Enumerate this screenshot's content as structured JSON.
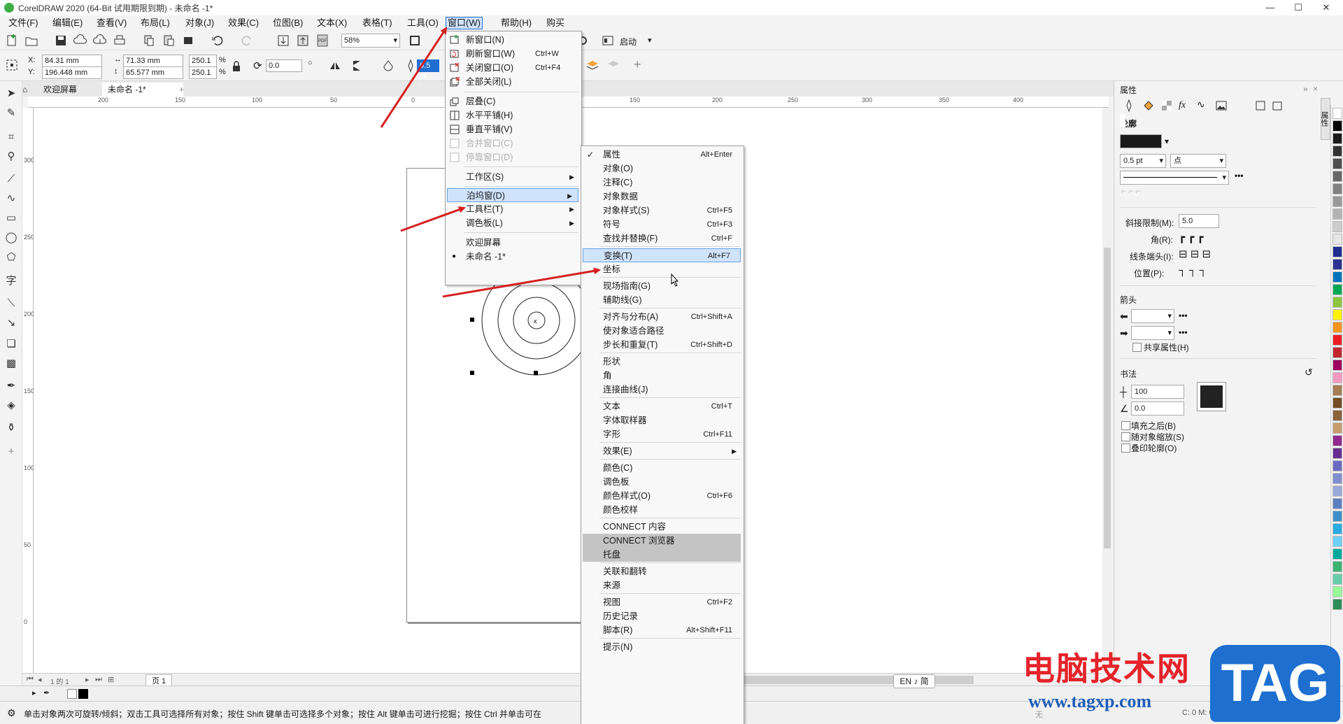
{
  "window": {
    "title": "CorelDRAW 2020 (64-Bit 试用期限到期) - 未命名 -1*",
    "controls": [
      "—",
      "☐",
      "✕"
    ]
  },
  "menubar": [
    "文件(F)",
    "编辑(E)",
    "查看(V)",
    "布局(L)",
    "对象(J)",
    "效果(C)",
    "位图(B)",
    "文本(X)",
    "表格(T)",
    "工具(O)",
    "窗口(W)",
    "帮助(H)",
    "购买"
  ],
  "toolbar": {
    "zoom": "58%",
    "launch_label": "启动"
  },
  "property_bar": {
    "x_label": "X:",
    "y_label": "Y:",
    "x_value": "84.31 mm",
    "y_value": "196.448 mm",
    "w_value": "71.33 mm",
    "h_value": "65.577 mm",
    "scale_x": "250.1",
    "scale_y": "250.1",
    "percent": "%",
    "rotation": "0.0",
    "outline_width": "0.5 pt"
  },
  "tabs": {
    "welcome": "欢迎屏幕",
    "document": "未命名 -1*"
  },
  "ruler_top": [
    "200",
    "150",
    "100",
    "50",
    "0",
    "50",
    "100",
    "150",
    "200",
    "250",
    "300",
    "350",
    "400"
  ],
  "ruler_left": [
    "300",
    "250",
    "200",
    "150",
    "100",
    "50",
    "0"
  ],
  "window_menu": {
    "items": [
      {
        "label": "新窗口(N)",
        "shortcut": ""
      },
      {
        "label": "刷新窗口(W)",
        "shortcut": "Ctrl+W"
      },
      {
        "label": "关闭窗口(O)",
        "shortcut": "Ctrl+F4"
      },
      {
        "label": "全部关闭(L)",
        "shortcut": ""
      },
      {
        "label": "层叠(C)",
        "shortcut": ""
      },
      {
        "label": "水平平铺(H)",
        "shortcut": ""
      },
      {
        "label": "垂直平铺(V)",
        "shortcut": ""
      },
      {
        "label": "合并窗口(C)",
        "shortcut": ""
      },
      {
        "label": "停靠窗口(D)",
        "shortcut": ""
      },
      {
        "label": "工作区(S)",
        "shortcut": ""
      },
      {
        "label": "泊坞窗(D)",
        "shortcut": ""
      },
      {
        "label": "工具栏(T)",
        "shortcut": ""
      },
      {
        "label": "调色板(L)",
        "shortcut": ""
      },
      {
        "label": "欢迎屏幕",
        "shortcut": ""
      },
      {
        "label": "未命名 -1*",
        "shortcut": ""
      }
    ]
  },
  "docker_submenu": {
    "items": [
      {
        "label": "属性",
        "shortcut": "Alt+Enter"
      },
      {
        "label": "对象(O)",
        "shortcut": ""
      },
      {
        "label": "注释(C)",
        "shortcut": ""
      },
      {
        "label": "对象数据",
        "shortcut": ""
      },
      {
        "label": "对象样式(S)",
        "shortcut": "Ctrl+F5"
      },
      {
        "label": "符号",
        "shortcut": "Ctrl+F3"
      },
      {
        "label": "查找并替换(F)",
        "shortcut": "Ctrl+F"
      },
      {
        "label": "变换(T)",
        "shortcut": "Alt+F7"
      },
      {
        "label": "坐标",
        "shortcut": ""
      },
      {
        "label": "现场指南(G)",
        "shortcut": ""
      },
      {
        "label": "辅助线(G)",
        "shortcut": ""
      },
      {
        "label": "对齐与分布(A)",
        "shortcut": "Ctrl+Shift+A"
      },
      {
        "label": "使对象适合路径",
        "shortcut": ""
      },
      {
        "label": "步长和重复(T)",
        "shortcut": "Ctrl+Shift+D"
      },
      {
        "label": "形状",
        "shortcut": ""
      },
      {
        "label": "角",
        "shortcut": ""
      },
      {
        "label": "连接曲线(J)",
        "shortcut": ""
      },
      {
        "label": "文本",
        "shortcut": "Ctrl+T"
      },
      {
        "label": "字体取样器",
        "shortcut": ""
      },
      {
        "label": "字形",
        "shortcut": "Ctrl+F11"
      },
      {
        "label": "效果(E)",
        "shortcut": ""
      },
      {
        "label": "颜色(C)",
        "shortcut": ""
      },
      {
        "label": "调色板",
        "shortcut": ""
      },
      {
        "label": "颜色样式(O)",
        "shortcut": "Ctrl+F6"
      },
      {
        "label": "颜色校样",
        "shortcut": ""
      },
      {
        "label": "CONNECT 内容",
        "shortcut": ""
      },
      {
        "label": "CONNECT 浏览器",
        "shortcut": ""
      },
      {
        "label": "托盘",
        "shortcut": ""
      },
      {
        "label": "关联和翻转",
        "shortcut": ""
      },
      {
        "label": "来源",
        "shortcut": ""
      },
      {
        "label": "视图",
        "shortcut": "Ctrl+F2"
      },
      {
        "label": "历史记录",
        "shortcut": ""
      },
      {
        "label": "脚本(R)",
        "shortcut": "Alt+Shift+F11"
      },
      {
        "label": "提示(N)",
        "shortcut": ""
      }
    ]
  },
  "docker": {
    "title": "属性",
    "section_outline": "轮廓",
    "width_value": "0.5 pt",
    "unit": "点",
    "miter_label": "斜接限制(M):",
    "miter_value": "5.0",
    "corner_label": "角(R):",
    "linecap_label": "线条端头(I):",
    "position_label": "位置(P):",
    "arrows_label": "箭头",
    "share_label": "共享属性(H)",
    "calligraphy_label": "书法",
    "stretch_value": "100",
    "angle_value": "0.0",
    "fill_behind": "填充之后(B)",
    "scale_with": "随对象缩放(S)",
    "overprint": "叠印轮廓(O)",
    "vertical_tab": "属性"
  },
  "palette_colors": [
    "#ffffff",
    "#000000",
    "#1a1a1a",
    "#333333",
    "#4d4d4d",
    "#666666",
    "#808080",
    "#999999",
    "#b3b3b3",
    "#cccccc",
    "#e6e6e6",
    "#1d2c8f",
    "#2e3192",
    "#0072bc",
    "#00a651",
    "#8dc63f",
    "#fff200",
    "#f7941d",
    "#ed1c24",
    "#c1272d",
    "#9e005d",
    "#f49ac1",
    "#a67c52",
    "#754c24",
    "#8c6239",
    "#c69c6d",
    "#92278f",
    "#662d91",
    "#6a6ac2",
    "#7f8fcf",
    "#9aa9d9",
    "#5a7fbf",
    "#3d8ec9",
    "#29abe2",
    "#6dcff6",
    "#00a99d",
    "#3cb371",
    "#66cdaa",
    "#98fb98",
    "#2e8b57"
  ],
  "page_nav": {
    "page_count_display": "1 的 1",
    "page_tab": "页 1"
  },
  "status": {
    "hint": "单击对象两次可旋转/倾斜；双击工具可选择所有对象；按住 Shift 键单击可选择多个对象；按住 Alt 键单击可进行挖掘；按住 Ctrl 并单击可在",
    "fill_none": "无",
    "color_info": "C: 0 M: 0 Y: 0 K: 100"
  },
  "ime": "EN ♪ 简",
  "watermark": {
    "text": "电脑技术网",
    "url": "www.tagxp.com",
    "tag": "TAG"
  }
}
